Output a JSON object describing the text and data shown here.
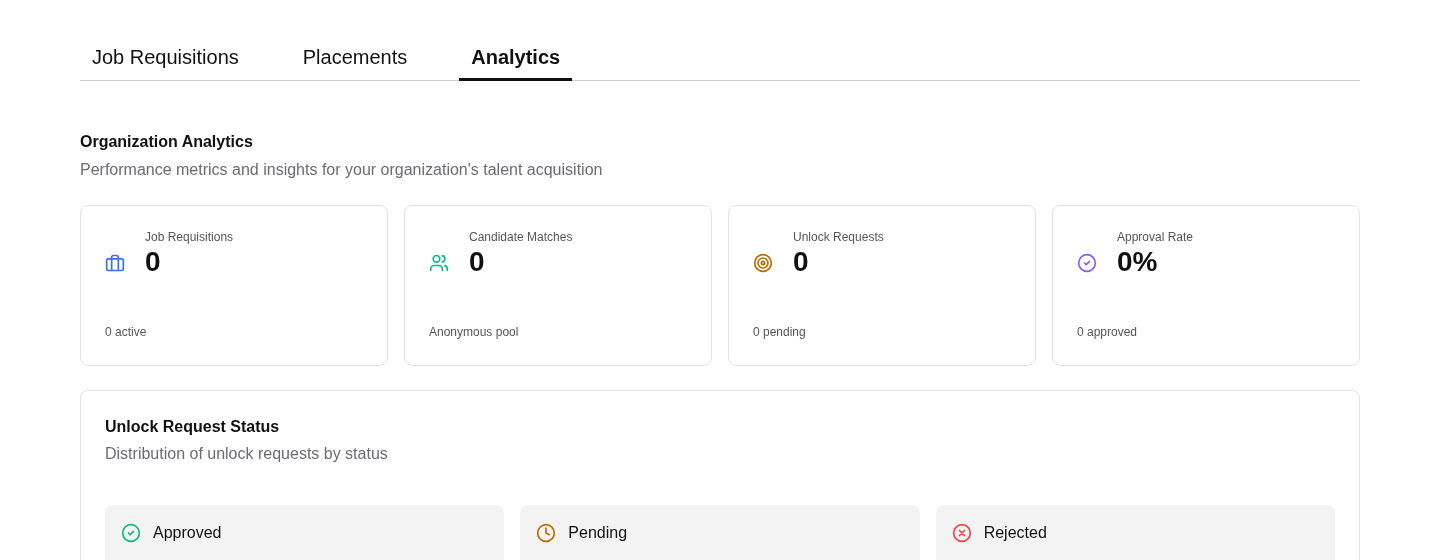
{
  "tabs": [
    {
      "label": "Job Requisitions",
      "selected": false
    },
    {
      "label": "Placements",
      "selected": false
    },
    {
      "label": "Analytics",
      "selected": true
    }
  ],
  "header": {
    "title": "Organization Analytics",
    "subtitle": "Performance metrics and insights for your organization's talent acquisition"
  },
  "stat_cards": [
    {
      "kind": "briefcase",
      "label": "Job Requisitions",
      "value": "0",
      "note": "0 active"
    },
    {
      "kind": "users",
      "label": "Candidate Matches",
      "value": "0",
      "note": "Anonymous pool"
    },
    {
      "kind": "target",
      "label": "Unlock Requests",
      "value": "0",
      "note": "0 pending"
    },
    {
      "kind": "check",
      "label": "Approval Rate",
      "value": "0%",
      "note": "0 approved"
    }
  ],
  "status_panel": {
    "title": "Unlock Request Status",
    "subtitle": "Distribution of unlock requests by status",
    "items": [
      {
        "kind": "check",
        "label": "Approved"
      },
      {
        "kind": "clock",
        "label": "Pending"
      },
      {
        "kind": "x",
        "label": "Rejected"
      }
    ]
  }
}
